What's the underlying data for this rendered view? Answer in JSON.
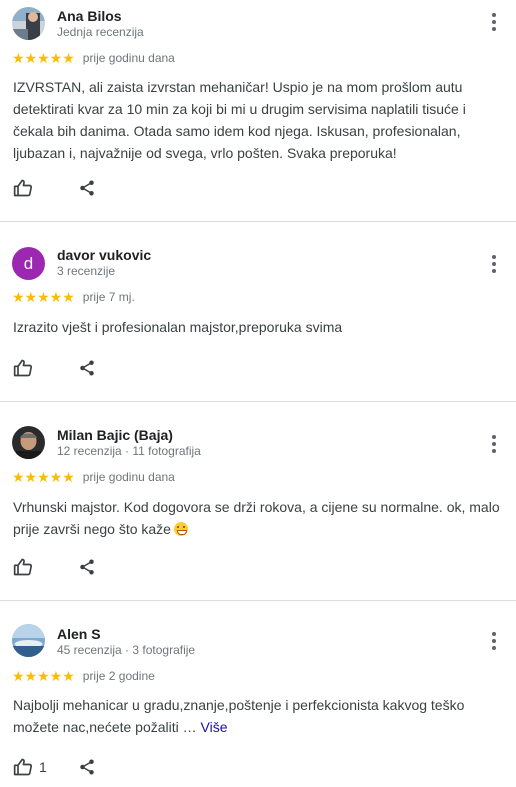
{
  "reviews": [
    {
      "name": "Ana Bilos",
      "meta": "Jednja recenzija",
      "stars": "★★★★★",
      "when": "prije godinu dana",
      "text": "IZVRSTAN, ali zaista izvrstan mehaničar! Uspio je na mom prošlom autu detektirati kvar za 10 min za koji bi mi u drugim servisima naplatili tisuće i čekala bih danima. Otada samo idem kod njega. Iskusan, profesionalan, ljubazan i, najvažnije od svega, vrlo pošten. Svaka preporuka!",
      "avatar_icon": "photo-avatar-icon"
    },
    {
      "name": "davor vukovic",
      "meta": "3 recenzije",
      "stars": "★★★★★",
      "when": "prije 7 mj.",
      "text": "Izrazito vješt i profesionalan majstor,preporuka svima",
      "avatar_letter": "d",
      "avatar_color": "#9c27b0"
    },
    {
      "name": "Milan Bajic (Baja)",
      "meta": "12 recenzija · 11 fotografija",
      "stars": "★★★★★",
      "when": "prije godinu dana",
      "text": "Vrhunski majstor. Kod dogovora se drži rokova, a cijene su normalne. ok, malo prije završi nego što kaže",
      "emoji_icon": "grinning-face-icon"
    },
    {
      "name": "Alen S",
      "meta": "45 recenzija · 3 fotografije",
      "stars": "★★★★★",
      "when": "prije 2 godine",
      "text": "Najbolji mehanicar u gradu,znanje,poštenje i perfekcionista kakvog teško možete nac,nećete požaliti … ",
      "more_label": "Više",
      "likes": "1"
    }
  ],
  "colors": {
    "star": "#fbbc04",
    "link": "#1a0dab",
    "divider": "#dadce0"
  }
}
